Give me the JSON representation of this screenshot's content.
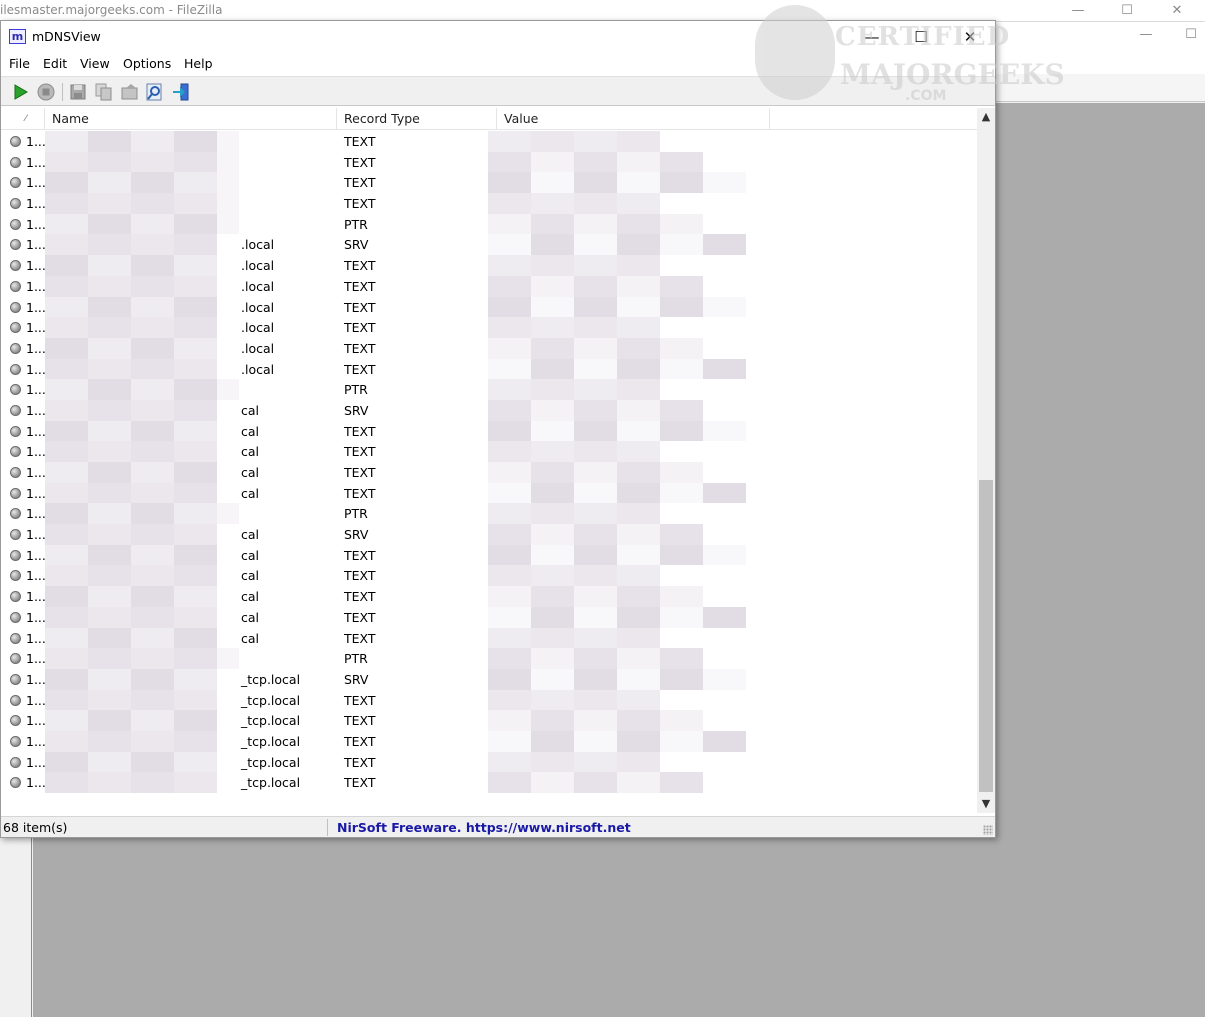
{
  "background_window": {
    "title": "ilesmaster.majorgeeks.com - FileZilla"
  },
  "watermark": {
    "line1": "CERTIFIED",
    "line2": "MAJORGEEKS",
    "line3": ".COM"
  },
  "window": {
    "title": "mDNSView",
    "icon_letter": "m",
    "minimize": "—",
    "maximize": "☐",
    "close": "✕"
  },
  "menu": [
    "File",
    "Edit",
    "View",
    "Options",
    "Help"
  ],
  "toolbar": [
    "start-icon",
    "stop-icon",
    "save-icon",
    "copy-icon",
    "properties-icon",
    "find-icon",
    "exit-icon"
  ],
  "columns": {
    "sort": "⁄",
    "name": "Name",
    "record_type": "Record Type",
    "value": "Value"
  },
  "rows": [
    {
      "idx": "1...",
      "name": "",
      "type": "TEXT"
    },
    {
      "idx": "1...",
      "name": "",
      "type": "TEXT"
    },
    {
      "idx": "1...",
      "name": "",
      "type": "TEXT"
    },
    {
      "idx": "1...",
      "name": "",
      "type": "TEXT"
    },
    {
      "idx": "1...",
      "name": "",
      "type": "PTR"
    },
    {
      "idx": "1...",
      "name": ".local",
      "type": "SRV"
    },
    {
      "idx": "1...",
      "name": ".local",
      "type": "TEXT"
    },
    {
      "idx": "1...",
      "name": ".local",
      "type": "TEXT"
    },
    {
      "idx": "1...",
      "name": ".local",
      "type": "TEXT"
    },
    {
      "idx": "1...",
      "name": ".local",
      "type": "TEXT"
    },
    {
      "idx": "1...",
      "name": ".local",
      "type": "TEXT"
    },
    {
      "idx": "1...",
      "name": ".local",
      "type": "TEXT"
    },
    {
      "idx": "1...",
      "name": "",
      "type": "PTR"
    },
    {
      "idx": "1...",
      "name": "cal",
      "type": "SRV"
    },
    {
      "idx": "1...",
      "name": "cal",
      "type": "TEXT"
    },
    {
      "idx": "1...",
      "name": "cal",
      "type": "TEXT"
    },
    {
      "idx": "1...",
      "name": "cal",
      "type": "TEXT"
    },
    {
      "idx": "1...",
      "name": "cal",
      "type": "TEXT"
    },
    {
      "idx": "1...",
      "name": "",
      "type": "PTR"
    },
    {
      "idx": "1...",
      "name": "cal",
      "type": "SRV"
    },
    {
      "idx": "1...",
      "name": "cal",
      "type": "TEXT"
    },
    {
      "idx": "1...",
      "name": "cal",
      "type": "TEXT"
    },
    {
      "idx": "1...",
      "name": "cal",
      "type": "TEXT"
    },
    {
      "idx": "1...",
      "name": "cal",
      "type": "TEXT"
    },
    {
      "idx": "1...",
      "name": "cal",
      "type": "TEXT"
    },
    {
      "idx": "1...",
      "name": "",
      "type": "PTR"
    },
    {
      "idx": "1...",
      "name": "_tcp.local",
      "type": "SRV"
    },
    {
      "idx": "1...",
      "name": "_tcp.local",
      "type": "TEXT"
    },
    {
      "idx": "1...",
      "name": "_tcp.local",
      "type": "TEXT"
    },
    {
      "idx": "1...",
      "name": "_tcp.local",
      "type": "TEXT"
    },
    {
      "idx": "1...",
      "name": "_tcp.local",
      "type": "TEXT"
    },
    {
      "idx": "1...",
      "name": "_tcp.local",
      "type": "TEXT"
    }
  ],
  "status": {
    "count": "68 item(s)",
    "link": "NirSoft Freeware. https://www.nirsoft.net"
  },
  "colors": {
    "link": "#1a1aa6",
    "pixelate_a": "#ece8ee",
    "pixelate_b": "#e3dee5"
  }
}
